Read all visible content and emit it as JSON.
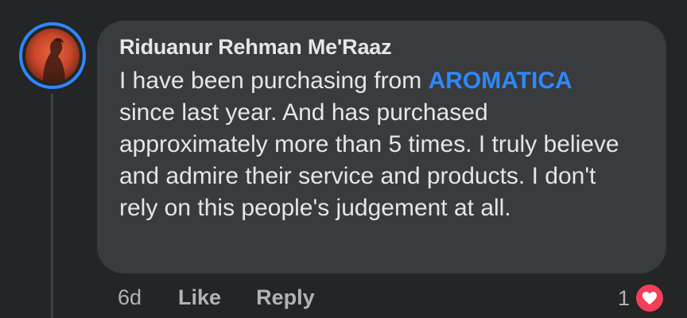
{
  "comment": {
    "author": "Riduanur Rehman Me'Raaz",
    "text_before_mention": "I have been purchasing from ",
    "mention": "AROMATICA",
    "text_after_mention": " since last year. And has purchased approximately more than 5 times. I truly believe and admire their service and products. I don't rely on this people's judgement at all.",
    "time": "6d",
    "like_label": "Like",
    "reply_label": "Reply",
    "reaction_count": "1",
    "reaction_icon": "heart-icon"
  },
  "colors": {
    "background": "#242526",
    "bubble": "#3a3b3c",
    "text": "#e4e6eb",
    "secondary_text": "#b0b3b8",
    "mention": "#2d88ff",
    "avatar_ring": "#2d88ff",
    "heart": "#f33e58"
  }
}
